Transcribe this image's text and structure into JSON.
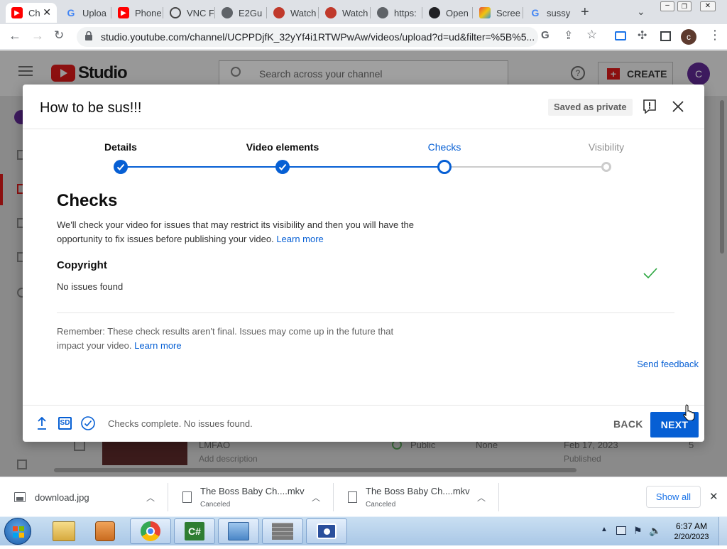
{
  "browser": {
    "tabs": [
      {
        "label": "Ch",
        "icon": "youtube-icon"
      },
      {
        "label": "Uploa",
        "icon": "google-icon"
      },
      {
        "label": "Phone",
        "icon": "youtube-icon"
      },
      {
        "label": "VNC F",
        "icon": "vnc-icon"
      },
      {
        "label": "E2Gu",
        "icon": "globe-icon"
      },
      {
        "label": "Watch",
        "icon": "film-icon"
      },
      {
        "label": "Watch",
        "icon": "film-icon"
      },
      {
        "label": "https:",
        "icon": "globe-icon"
      },
      {
        "label": "Open",
        "icon": "openai-icon"
      },
      {
        "label": "Scree",
        "icon": "screencast-icon"
      },
      {
        "label": "sussy",
        "icon": "google-icon"
      }
    ],
    "url": "studio.youtube.com/channel/UCPPDjfK_32yYf4i1RTWPwAw/videos/upload?d=ud&filter=%5B%5...",
    "profile_initial": "c"
  },
  "studio": {
    "logo_text": "Studio",
    "search_placeholder": "Search across your channel",
    "create_label": "CREATE",
    "avatar_initial": "C",
    "row": {
      "title": "LMFAO",
      "description": "Add description",
      "visibility": "Public",
      "restrictions": "None",
      "date": "Feb 17, 2023",
      "status": "Published",
      "count": "5"
    }
  },
  "modal": {
    "title": "How to be sus!!!",
    "saved_badge": "Saved as private",
    "steps": [
      {
        "label": "Details",
        "state": "done"
      },
      {
        "label": "Video elements",
        "state": "done"
      },
      {
        "label": "Checks",
        "state": "current"
      },
      {
        "label": "Visibility",
        "state": "pending"
      }
    ],
    "heading": "Checks",
    "intro_line1": "We'll check your video for issues that may restrict its visibility and then you will have the",
    "intro_line2": "opportunity to fix issues before publishing your video.",
    "learn_more": "Learn more",
    "copyright_title": "Copyright",
    "copyright_status": "No issues found",
    "remember_line1": "Remember: These check results aren't final. Issues may come up in the future that",
    "remember_line2": "impact your video.",
    "send_feedback": "Send feedback",
    "footer_status": "Checks complete. No issues found.",
    "sd_badge": "SD",
    "back_label": "BACK",
    "next_label": "NEXT"
  },
  "downloads": {
    "items": [
      {
        "name": "download.jpg",
        "status": ""
      },
      {
        "name": "The Boss Baby Ch....mkv",
        "status": "Canceled"
      },
      {
        "name": "The Boss Baby Ch....mkv",
        "status": "Canceled"
      }
    ],
    "show_all": "Show all"
  },
  "taskbar": {
    "time": "6:37 AM",
    "date": "2/20/2023"
  },
  "colors": {
    "accent": "#065fd4",
    "youtube_red": "#ff0000",
    "avatar": "#6b2fa4"
  }
}
